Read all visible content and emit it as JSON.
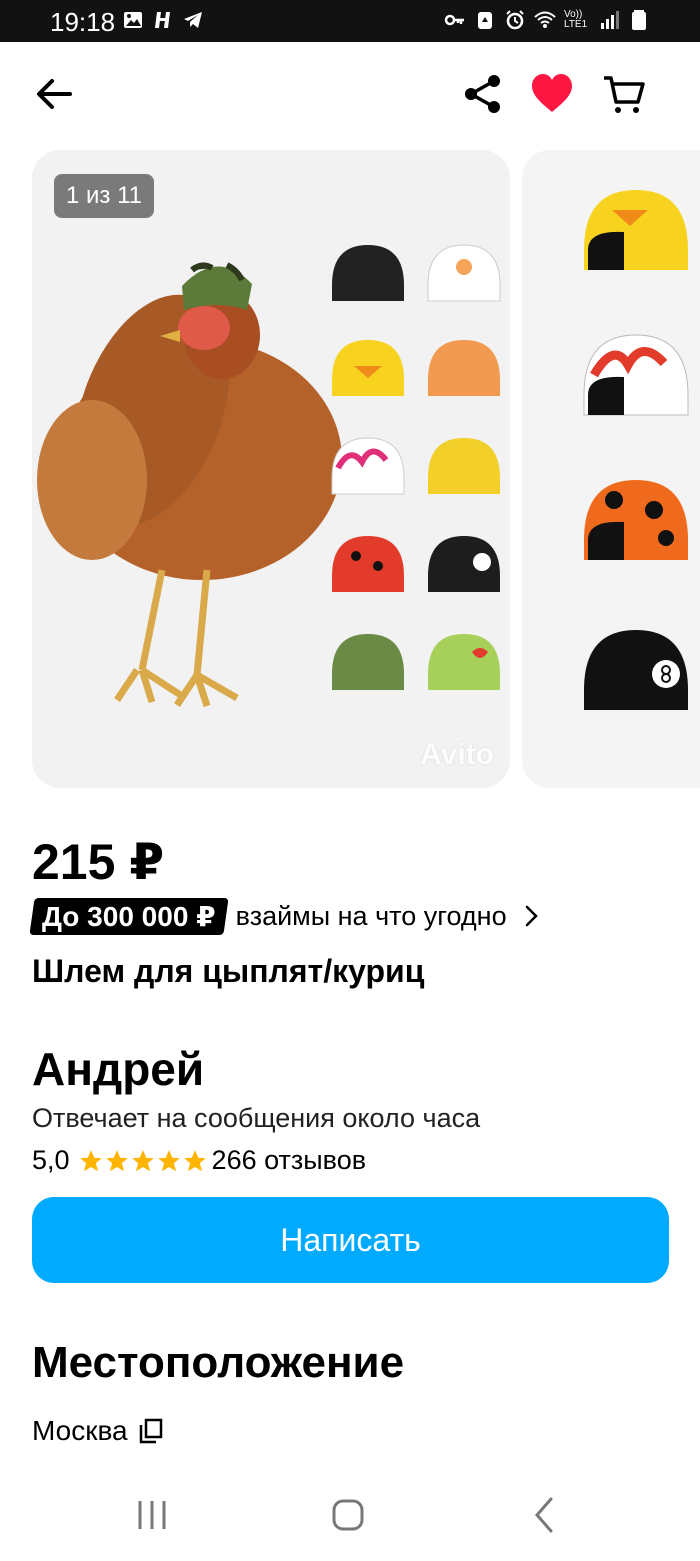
{
  "status_bar": {
    "time": "19:18",
    "left_icons": [
      "image-icon",
      "h-app-icon",
      "telegram-icon"
    ],
    "right_icons": [
      "key-icon",
      "recycle-icon",
      "alarm-icon",
      "wifi-icon",
      "volte-icon",
      "signal-icon",
      "battery-icon"
    ],
    "volte_label": "Vo)) LTE1"
  },
  "toolbar": {
    "back_icon": "arrow-left-icon",
    "share_icon": "share-icon",
    "favorite_icon": "heart-icon",
    "cart_icon": "cart-icon",
    "favorite_color": "#ff1744"
  },
  "gallery": {
    "counter": "1 из 11",
    "watermark": "Avito"
  },
  "listing": {
    "price": "215 ₽",
    "loan_badge": "До 300 000 ₽",
    "loan_text": "взаймы на что угодно",
    "title": "Шлем для цыплят/куриц"
  },
  "seller": {
    "name": "Андрей",
    "reply_time": "Отвечает на сообщения около часа",
    "rating": "5,0",
    "stars": 5,
    "reviews": "266 отзывов",
    "star_color": "#ffb400"
  },
  "actions": {
    "write_label": "Написать",
    "accent": "#00aaff"
  },
  "location": {
    "heading": "Местоположение",
    "city": "Москва"
  },
  "navbar": {
    "icons": [
      "recent-apps-icon",
      "home-icon",
      "back-icon"
    ]
  }
}
